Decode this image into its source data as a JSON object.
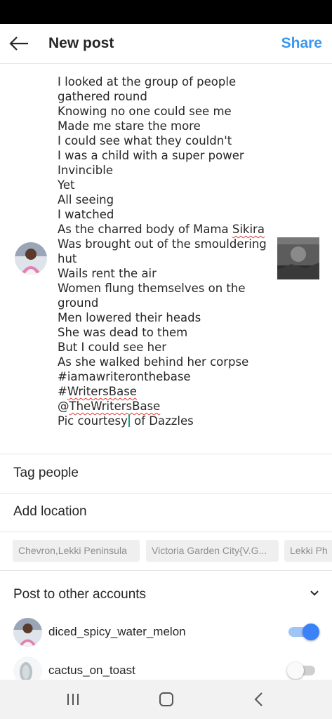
{
  "header": {
    "title": "New post",
    "share_label": "Share"
  },
  "caption": {
    "lines": [
      "I looked at the group of people",
      "gathered round",
      "Knowing no one could see me",
      "Made me stare the more",
      "I could see what they couldn't",
      "I was a child with a super power",
      "Invincible",
      "Yet",
      "All seeing",
      "I watched",
      "As the charred body of Mama ",
      "Sikira",
      "Was brought out of the smouldering",
      "hut",
      "Wails rent the air",
      "Women flung themselves on the",
      "ground",
      "Men lowered their heads",
      "She was dead to them",
      "But I could see her",
      "As she walked behind her corpse",
      "#iamawriteronthebase",
      "#",
      "WritersBase",
      "@",
      "TheWritersBase",
      "Pic courtesy",
      " of Dazzles"
    ]
  },
  "rows": {
    "tag_people": "Tag people",
    "add_location": "Add location"
  },
  "location_chips": [
    "Chevron,Lekki Peninsula",
    "Victoria Garden City{V.G...",
    "Lekki Ph"
  ],
  "other_accounts": {
    "label": "Post to other accounts",
    "accounts": [
      {
        "name": "diced_spicy_water_melon",
        "enabled": true
      },
      {
        "name": "cactus_on_toast",
        "enabled": false
      }
    ]
  },
  "colors": {
    "accent": "#3897f0",
    "toggle_on": "#3b82f6",
    "toggle_off_track": "#cfcfcf",
    "text": "#262626",
    "chip_text": "#8e8e8e"
  },
  "icons": {
    "back": "arrow-left-icon",
    "chevron": "chevron-down-icon",
    "nav_recents": "recents-icon",
    "nav_home": "home-icon",
    "nav_back": "nav-back-icon"
  }
}
